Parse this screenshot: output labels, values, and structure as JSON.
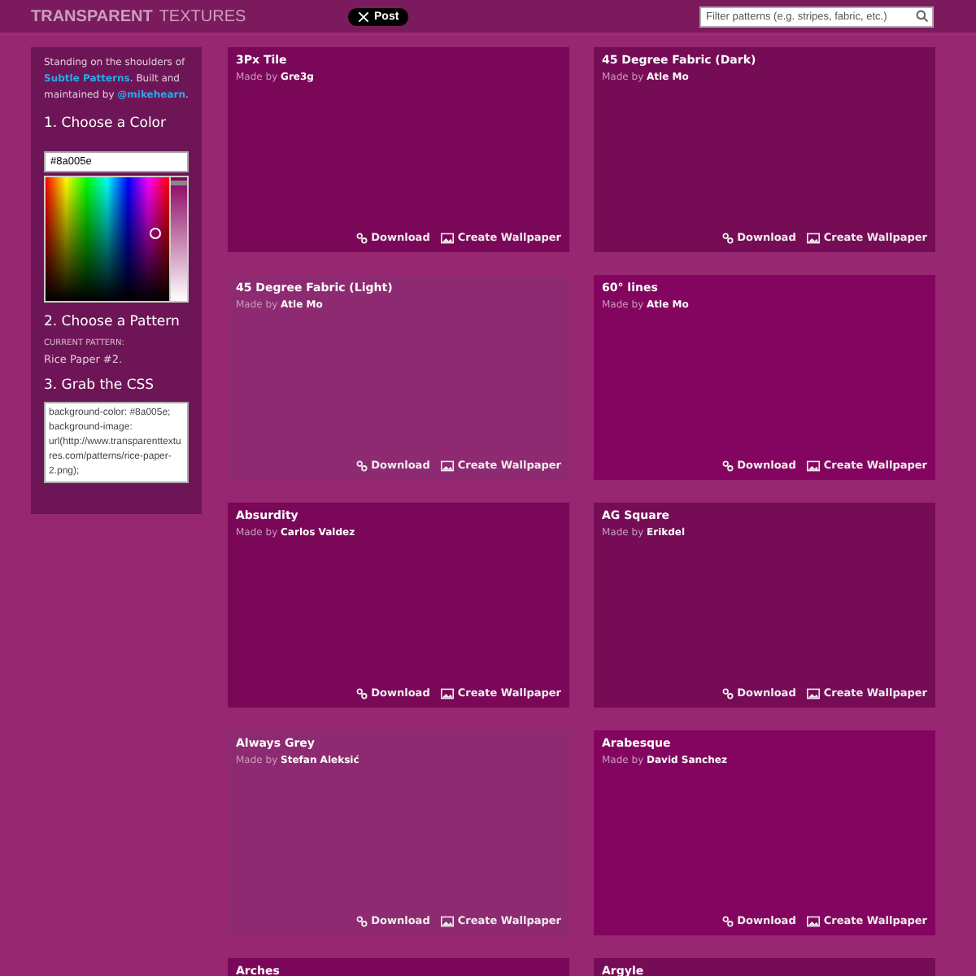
{
  "header": {
    "logo_bold": "TRANSPARENT",
    "logo_light": "TEXTURES",
    "post_button": "Post",
    "search": {
      "placeholder": "Filter patterns (e.g. stripes, fabric, etc.)"
    }
  },
  "sidebar": {
    "intro": "Standing on the shoulders of **Subtle Patterns**. Built and maintained by **@mikehearn**.",
    "step_1": "1. Choose a Color",
    "color_value": "#8a005e",
    "lightness": {
      "level": 0.97
    },
    "step_2": "2. Choose a Pattern",
    "current_label": "CURRENT PATTERN:",
    "current_pattern": "Rice Paper #2.",
    "step_3": "3. Grab the CSS",
    "css": "background-color: #8a005e;\nbackground-image: url(http://www.transparenttextures.com/patterns/rice-paper-2.png);"
  },
  "patterns": [
    {
      "title": "3Px Tile",
      "made_by": "Made by",
      "author": "Gre3g",
      "download": "Download",
      "wallpaper": "Create Wallpaper"
    },
    {
      "title": "45 Degree Fabric (Dark)",
      "made_by": "Made by",
      "author": "Atle Mo",
      "download": "Download",
      "wallpaper": "Create Wallpaper"
    },
    {
      "title": "45 Degree Fabric (Light)",
      "made_by": "Made by",
      "author": "Atle Mo",
      "download": "Download",
      "wallpaper": "Create Wallpaper"
    },
    {
      "title": "60° lines",
      "made_by": "Made by",
      "author": "Atle Mo",
      "download": "Download",
      "wallpaper": "Create Wallpaper"
    },
    {
      "title": "Absurdity",
      "made_by": "Made by",
      "author": "Carlos Valdez",
      "download": "Download",
      "wallpaper": "Create Wallpaper"
    },
    {
      "title": "AG Square",
      "made_by": "Made by",
      "author": "Erikdel",
      "download": "Download",
      "wallpaper": "Create Wallpaper"
    },
    {
      "title": "Always Grey",
      "made_by": "Made by",
      "author": "Stefan Aleksić",
      "download": "Download",
      "wallpaper": "Create Wallpaper"
    },
    {
      "title": "Arabesque",
      "made_by": "Made by",
      "author": "David Sanchez",
      "download": "Download",
      "wallpaper": "Create Wallpaper"
    },
    {
      "title": "Arches"
    },
    {
      "title": "Argyle"
    }
  ]
}
